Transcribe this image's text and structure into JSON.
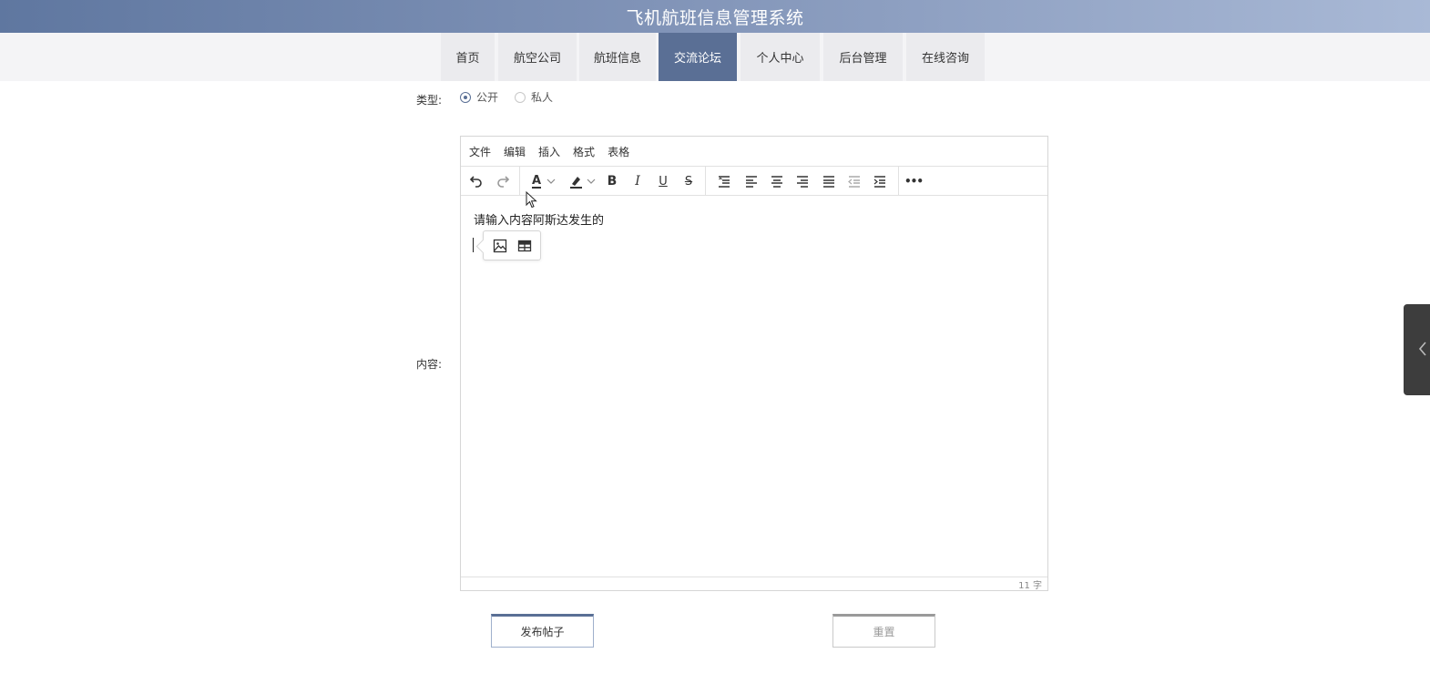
{
  "header": {
    "title": "飞机航班信息管理系统"
  },
  "nav": {
    "items": [
      {
        "label": "首页"
      },
      {
        "label": "航空公司"
      },
      {
        "label": "航班信息"
      },
      {
        "label": "交流论坛"
      },
      {
        "label": "个人中心"
      },
      {
        "label": "后台管理"
      },
      {
        "label": "在线咨询"
      }
    ],
    "active": "交流论坛"
  },
  "form": {
    "type_label": "类型:",
    "type_options": [
      {
        "label": "公开",
        "checked": true
      },
      {
        "label": "私人",
        "checked": false
      }
    ],
    "content_label": "内容:"
  },
  "editor": {
    "menus": [
      {
        "label": "文件"
      },
      {
        "label": "编辑"
      },
      {
        "label": "插入"
      },
      {
        "label": "格式"
      },
      {
        "label": "表格"
      }
    ],
    "toolbar_icons": [
      "undo-icon",
      "redo-icon",
      "text-color-icon",
      "highlight-icon",
      "bold-icon",
      "italic-icon",
      "underline-icon",
      "strikethrough-icon",
      "line-height-icon",
      "align-left-icon",
      "align-center-icon",
      "align-right-icon",
      "justify-icon",
      "outdent-icon",
      "indent-icon",
      "more-icon"
    ],
    "toolbar_text": {
      "bold": "B",
      "italic": "I",
      "underline": "U",
      "strike": "S",
      "text_color": "A",
      "more": "•••"
    },
    "content": "请输入内容阿斯达发生的",
    "word_count": "11 字"
  },
  "buttons": {
    "submit": "发布帖子",
    "reset": "重置"
  },
  "colors": {
    "accent": "#5a6f95",
    "header_start": "#5f77a0",
    "header_end": "#a9b9d6"
  }
}
